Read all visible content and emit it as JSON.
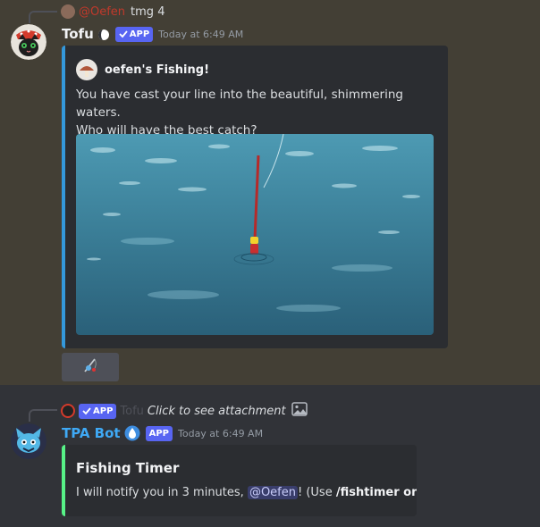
{
  "message1": {
    "reply": {
      "username": "@Oefen",
      "text": "tmg 4"
    },
    "author": {
      "name": "Tofu",
      "app_badge": "APP",
      "timestamp": "Today at 6:49 AM",
      "status_icon": "moon-icon"
    },
    "embed": {
      "accent_color": "#3498db",
      "author_name": "oefen's Fishing!",
      "description_line1": "You have cast your line into the beautiful, shimmering waters.",
      "description_line2": "Who will have the best catch?",
      "image_icon": "fishing-float-icon"
    },
    "action_button_icon": "fishing-rod-icon"
  },
  "message2": {
    "reply": {
      "app_badge": "APP",
      "username": "Tofu",
      "text": "Click to see attachment",
      "icon": "image-icon"
    },
    "author": {
      "name": "TPA Bot",
      "app_badge": "APP",
      "timestamp": "Today at 6:49 AM",
      "status_icon": "water-drop-icon"
    },
    "embed": {
      "accent_color": "#57f287",
      "title": "Fishing Timer",
      "description_prefix": "I will notify you in 3 minutes, ",
      "mention": "@Oefen",
      "description_mid": "! (Use ",
      "command": "/fishtimer on|off",
      "description_suffix": ")"
    }
  }
}
